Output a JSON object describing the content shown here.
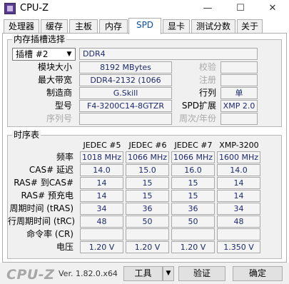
{
  "window": {
    "title": "CPU-Z",
    "controls": {
      "minimize": "—",
      "maximize": "☐",
      "close": "✕"
    }
  },
  "tabs": [
    "处理器",
    "缓存",
    "主板",
    "内存",
    "SPD",
    "显卡",
    "测试分数",
    "关于"
  ],
  "active_tab": "SPD",
  "slot_group": {
    "title": "内存插槽选择",
    "slot_select": "插槽 #2",
    "module_type": "DDR4",
    "rows": [
      {
        "label": "模块大小",
        "value": "8192 MBytes",
        "right_label": "校验",
        "right_value": "",
        "dim": true
      },
      {
        "label": "最大带宽",
        "value": "DDR4-2132 (1066 MHz)",
        "right_label": "注册",
        "right_value": "",
        "dim": true
      },
      {
        "label": "制造商",
        "value": "G.Skill",
        "right_label": "行列",
        "right_value": "单",
        "dim": false
      },
      {
        "label": "型号",
        "value": "F4-3200C14-8GTZR",
        "right_label": "SPD扩展",
        "right_value": "XMP 2.0",
        "dim": false
      },
      {
        "label": "序列号",
        "value": "",
        "right_label": "周次/年份",
        "right_value": "",
        "dim": true
      }
    ]
  },
  "timings_group": {
    "title": "时序表",
    "columns": [
      "JEDEC #5",
      "JEDEC #6",
      "JEDEC #7",
      "XMP-3200"
    ],
    "rows": [
      {
        "label": "频率",
        "values": [
          "1018 MHz",
          "1066 MHz",
          "1066 MHz",
          "1600 MHz"
        ]
      },
      {
        "label": "CAS# 延迟",
        "values": [
          "14.0",
          "15.0",
          "16.0",
          "14.0"
        ]
      },
      {
        "label": "RAS# 到CAS#",
        "values": [
          "14",
          "15",
          "15",
          "14"
        ]
      },
      {
        "label": "RAS# 预充电",
        "values": [
          "14",
          "15",
          "15",
          "14"
        ]
      },
      {
        "label": "周期时间 (tRAS)",
        "values": [
          "34",
          "36",
          "36",
          "34"
        ]
      },
      {
        "label": "行周期时间 (tRC)",
        "values": [
          "48",
          "50",
          "50",
          "48"
        ]
      },
      {
        "label": "命令率 (CR)",
        "values": [
          "",
          "",
          "",
          ""
        ]
      },
      {
        "label": "电压",
        "values": [
          "1.20 V",
          "1.20 V",
          "1.20 V",
          "1.350 V"
        ]
      }
    ]
  },
  "footer": {
    "brand": "CPU-Z",
    "version": "Ver. 1.82.0.x64",
    "tools_label": "工具",
    "validate_label": "验证",
    "ok_label": "确定"
  }
}
